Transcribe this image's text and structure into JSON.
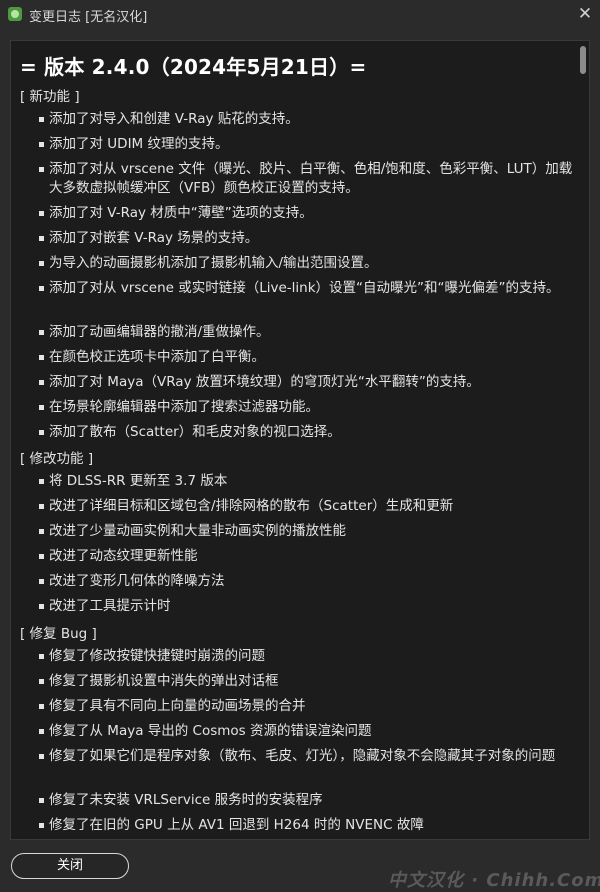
{
  "window": {
    "title": "变更日志 [无名汉化]",
    "close_glyph": "✕"
  },
  "changelog": {
    "version_heading": "= 版本 2.4.0（2024年5月21日）=",
    "sections": [
      {
        "header": "[ 新功能 ]",
        "items": [
          "添加了对导入和创建 V-Ray 贴花的支持。",
          "添加了对 UDIM 纹理的支持。",
          "添加了对从 vrscene 文件（曝光、胶片、白平衡、色相/饱和度、色彩平衡、LUT）加载大多数虚拟帧缓冲区（VFB）颜色校正设置的支持。",
          "添加了对 V-Ray 材质中“薄壁”选项的支持。",
          "添加了对嵌套 V-Ray 场景的支持。",
          "为导入的动画摄影机添加了摄影机输入/输出范围设置。",
          "添加了对从 vrscene 或实时链接（Live-link）设置“自动曝光”和“曝光偏差”的支持。",
          "添加了动画编辑器的撤消/重做操作。",
          "在颜色校正选项卡中添加了白平衡。",
          "添加了对 Maya（VRay 放置环境纹理）的穹顶灯光“水平翻转”的支持。",
          "在场景轮廓编辑器中添加了搜索过滤器功能。",
          "添加了散布（Scatter）和毛皮对象的视口选择。"
        ]
      },
      {
        "header": "[ 修改功能 ]",
        "items": [
          "将 DLSS-RR 更新至 3.7 版本",
          "改进了详细目标和区域包含/排除网格的散布（Scatter）生成和更新",
          "改进了少量动画实例和大量非动画实例的播放性能",
          "改进了动态纹理更新性能",
          "改进了变形几何体的降噪方法",
          "改进了工具提示计时"
        ]
      },
      {
        "header": "[ 修复 Bug ]",
        "items": [
          "修复了修改按键快捷键时崩溃的问题",
          "修复了摄影机设置中消失的弹出对话框",
          "修复了具有不同向上向量的动画场景的合并",
          "修复了从 Maya 导出的 Cosmos 资源的错误渲染问题",
          "修复了如果它们是程序对象（散布、毛皮、灯光），隐藏对象不会隐藏其子对象的问题",
          "修复了未安装 VRLService 服务时的安装程序",
          "修复了在旧的 GPU 上从 AV1 回退到 H264 时的 NVENC 故障"
        ]
      }
    ]
  },
  "footer": {
    "close_button_label": "关闭",
    "watermark_text": "中文汉化 · Chihh.Com"
  },
  "icons": {
    "app": "app-logo-icon",
    "close": "close-icon"
  },
  "colors": {
    "window_bg": "#2b2b2b",
    "content_bg": "#1c1c1c",
    "text": "#e4e4e4",
    "heading": "#ffffff"
  }
}
